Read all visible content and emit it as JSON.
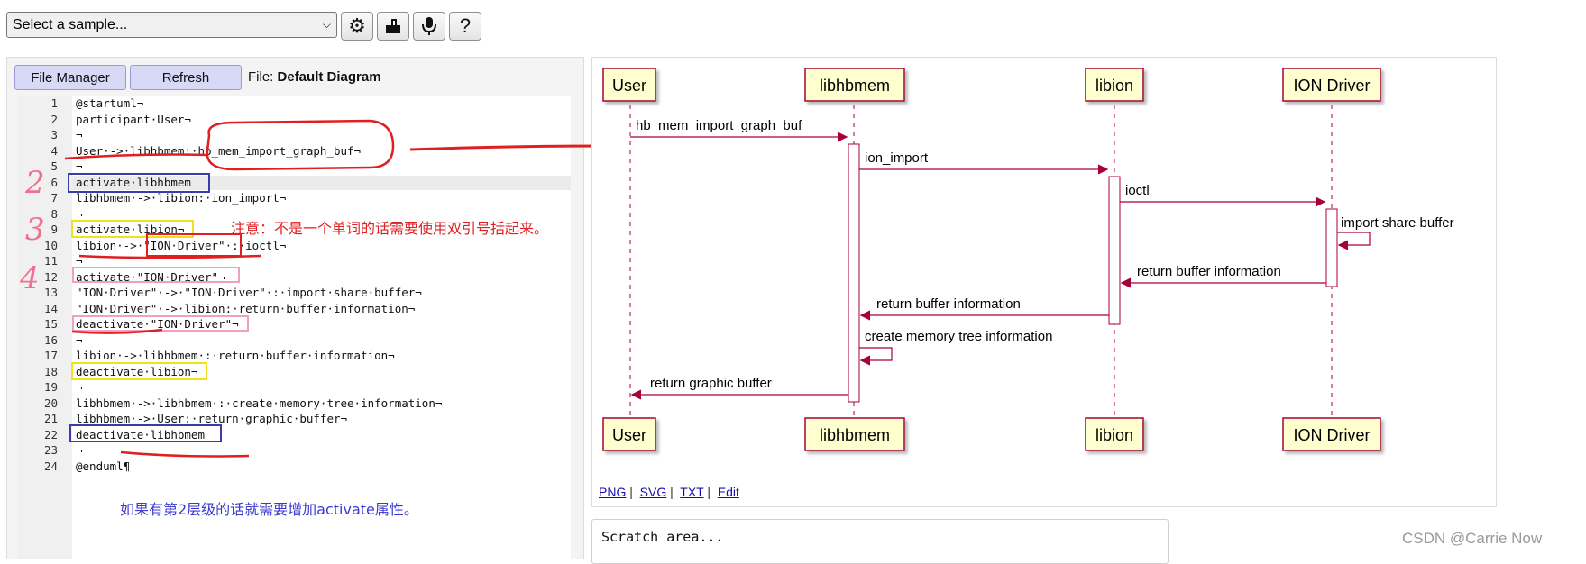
{
  "toolbar": {
    "sample_select": "Select a sample...",
    "buttons": [
      "settings-gear",
      "share-export",
      "microphone",
      "help"
    ],
    "help_label": "?"
  },
  "editor_panel": {
    "file_manager_label": "File Manager",
    "refresh_label": "Refresh",
    "file_prefix": "File:",
    "file_name": "Default Diagram",
    "lines": [
      {
        "n": "1",
        "text": "@startuml¬"
      },
      {
        "n": "2",
        "text": "participant·User¬"
      },
      {
        "n": "3",
        "text": "¬"
      },
      {
        "n": "4",
        "text": "User·->·libhbmem:·hb_mem_import_graph_buf¬"
      },
      {
        "n": "5",
        "text": "¬"
      },
      {
        "n": "6",
        "text": "activate·libhbmem"
      },
      {
        "n": "7",
        "text": "libhbmem·->·libion:·ion_import¬"
      },
      {
        "n": "8",
        "text": "¬"
      },
      {
        "n": "9",
        "text": "activate·libion¬"
      },
      {
        "n": "10",
        "text": "libion·->·\"ION·Driver\"·:·ioctl¬"
      },
      {
        "n": "11",
        "text": "¬"
      },
      {
        "n": "12",
        "text": "activate·\"ION·Driver\"¬"
      },
      {
        "n": "13",
        "text": "\"ION·Driver\"·->·\"ION·Driver\"·:·import·share·buffer¬"
      },
      {
        "n": "14",
        "text": "\"ION·Driver\"·->·libion:·return·buffer·information¬"
      },
      {
        "n": "15",
        "text": "deactivate·\"ION·Driver\"¬"
      },
      {
        "n": "16",
        "text": "¬"
      },
      {
        "n": "17",
        "text": "libion·->·libhbmem·:·return·buffer·information¬"
      },
      {
        "n": "18",
        "text": "deactivate·libion¬"
      },
      {
        "n": "19",
        "text": "¬"
      },
      {
        "n": "20",
        "text": "libhbmem·->·libhbmem·:·create·memory·tree·information¬"
      },
      {
        "n": "21",
        "text": "libhbmem·->·User:·return·graphic·buffer¬"
      },
      {
        "n": "22",
        "text": "deactivate·libhbmem"
      },
      {
        "n": "23",
        "text": "¬"
      },
      {
        "n": "24",
        "text": "@enduml¶"
      }
    ],
    "annotation_red": "注意：不是一个单词的话需要使用双引号括起来。",
    "annotation_blue": "如果有第2层级的话就需要增加activate属性。",
    "handwritten_numbers": [
      "2",
      "3",
      "4"
    ]
  },
  "diagram": {
    "participants": [
      "User",
      "libhbmem",
      "libion",
      "ION Driver"
    ],
    "messages": [
      "hb_mem_import_graph_buf",
      "ion_import",
      "ioctl",
      "import share buffer",
      "return buffer information",
      "return buffer information",
      "create memory tree information",
      "return graphic buffer"
    ],
    "export_links": [
      "PNG",
      "SVG",
      "TXT",
      "Edit"
    ],
    "link_separator": "|"
  },
  "scratch_area": "Scratch area...",
  "watermark": "CSDN @Carrie Now",
  "colors": {
    "participant_fill": "#fefece",
    "participant_border": "#a80036",
    "arrow": "#a80036",
    "annotation_red": "#e02020",
    "annotation_blue": "#3a3ad0",
    "box_blue": "#3b3bb0",
    "box_yellow": "#f2e020",
    "box_pink": "#f0a0c0"
  }
}
